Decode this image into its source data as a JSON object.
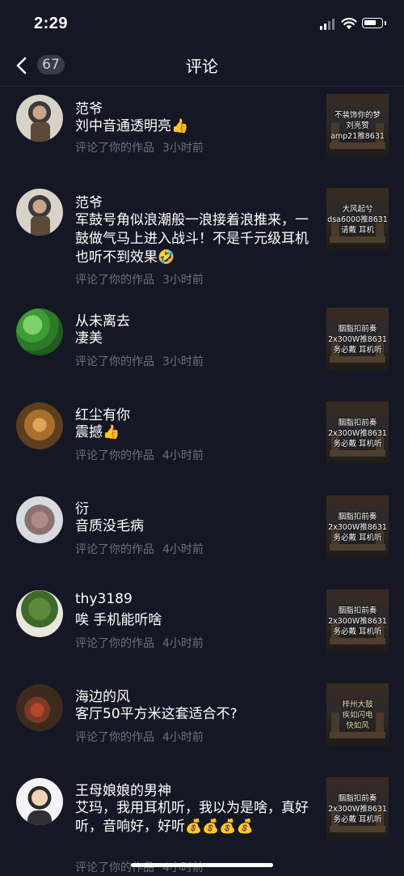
{
  "status": {
    "time": "2:29"
  },
  "nav": {
    "count": "67",
    "title": "评论"
  },
  "comments": [
    {
      "name": "范爷",
      "text": "刘中音通透明亮👍",
      "action": "评论了你的作品",
      "time": "3小时前",
      "thumb": "不装饰你的梦\n刘亮赞\namp21推8631",
      "avatar": "portrait-man"
    },
    {
      "name": "范爷",
      "text": "军鼓号角似浪潮般一浪接着浪推来，一鼓做气马上进入战斗！不是千元级耳机也听不到效果🤣",
      "action": "评论了你的作品",
      "time": "3小时前",
      "thumb": "大风起兮\ndsa6000推8631\n请戴  耳机",
      "avatar": "portrait-man"
    },
    {
      "name": "从未离去",
      "text": "凄美",
      "action": "评论了你的作品",
      "time": "3小时前",
      "thumb": "胭脂扣前奏\n2x300W推8631\n务必戴  耳机听",
      "avatar": "clover"
    },
    {
      "name": "红尘有你",
      "text": "震撼👍",
      "action": "评论了你的作品",
      "time": "4小时前",
      "thumb": "胭脂扣前奏\n2x300W推8631\n务必戴  耳机听",
      "avatar": "lion"
    },
    {
      "name": "衍",
      "text": "音质没毛病",
      "action": "评论了你的作品",
      "time": "4小时前",
      "thumb": "胭脂扣前奏\n2x300W推8631\n务必戴  耳机听",
      "avatar": "bird"
    },
    {
      "name": "thy3189",
      "text": "唉 手机能听啥",
      "action": "评论了你的作品",
      "time": "4小时前",
      "thumb": "胭脂扣前奏\n2x300W推8631\n务必戴  耳机听",
      "avatar": "bonsai"
    },
    {
      "name": "海边的风",
      "text": "客厅50平方米这套适合不?",
      "action": "评论了你的作品",
      "time": "4小时前",
      "thumb": "梓州大鼓\n疾如闪电\n快如风",
      "avatar": "tea"
    },
    {
      "name": "王母娘娘的男神",
      "text": "艾玛，我用耳机听，我以为是啥，真好听，音响好，好听💰💰💰💰",
      "action": "评论了你的作品",
      "time": "4小时前",
      "thumb": "胭脂扣前奏\n2x300W推8631\n务必戴  耳机听",
      "avatar": "young-man"
    }
  ]
}
